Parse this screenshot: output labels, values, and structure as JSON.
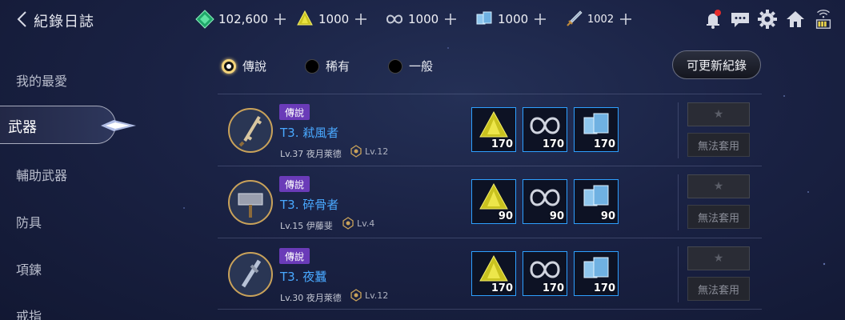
{
  "header": {
    "title": "紀錄日誌",
    "back_icon": "chevron-left-icon"
  },
  "resources": [
    {
      "name": "green-gem-icon",
      "amount": "102,600"
    },
    {
      "name": "yellow-crystal-icon",
      "amount": "1000"
    },
    {
      "name": "silver-infinity-icon",
      "amount": "1000"
    },
    {
      "name": "ice-crystal-icon",
      "amount": "1000"
    },
    {
      "name": "dagger-icon",
      "amount": "1002"
    }
  ],
  "system_icons": [
    "bell-icon",
    "chat-icon",
    "gear-icon",
    "home-icon",
    "battery-icon"
  ],
  "sidebar": {
    "items": [
      {
        "label": "我的最愛"
      },
      {
        "label": "武器",
        "active": true
      },
      {
        "label": "輔助武器"
      },
      {
        "label": "防具"
      },
      {
        "label": "項鍊"
      },
      {
        "label": "戒指"
      }
    ]
  },
  "filters": [
    {
      "label": "傳說",
      "selected": true
    },
    {
      "label": "稀有",
      "selected": false
    },
    {
      "label": "一般",
      "selected": false
    }
  ],
  "update_button": "可更新紀錄",
  "rows": [
    {
      "badge": "傳說",
      "name": "T3. 弒風者",
      "level_text": "Lv.37 夜月萊德",
      "sub_level": "Lv.12",
      "materials": [
        {
          "icon": "yellow-crystal-icon",
          "count": "170"
        },
        {
          "icon": "silver-infinity-icon",
          "count": "170"
        },
        {
          "icon": "ice-crystal-icon",
          "count": "170"
        }
      ],
      "star": "★",
      "action": "無法套用"
    },
    {
      "badge": "傳說",
      "name": "T3. 碎骨者",
      "level_text": "Lv.15 伊藤斐",
      "sub_level": "Lv.4",
      "materials": [
        {
          "icon": "yellow-crystal-icon",
          "count": "90"
        },
        {
          "icon": "silver-infinity-icon",
          "count": "90"
        },
        {
          "icon": "ice-crystal-icon",
          "count": "90"
        }
      ],
      "star": "★",
      "action": "無法套用"
    },
    {
      "badge": "傳說",
      "name": "T3. 夜蠶",
      "level_text": "Lv.30 夜月萊德",
      "sub_level": "Lv.12",
      "materials": [
        {
          "icon": "yellow-crystal-icon",
          "count": "170"
        },
        {
          "icon": "silver-infinity-icon",
          "count": "170"
        },
        {
          "icon": "ice-crystal-icon",
          "count": "170"
        }
      ],
      "star": "★",
      "action": "無法套用"
    }
  ],
  "colors": {
    "legend_badge": "#6a3bb8",
    "name_blue": "#49a8ff",
    "material_border": "#2ea0ff",
    "gold": "#f3d37a"
  }
}
